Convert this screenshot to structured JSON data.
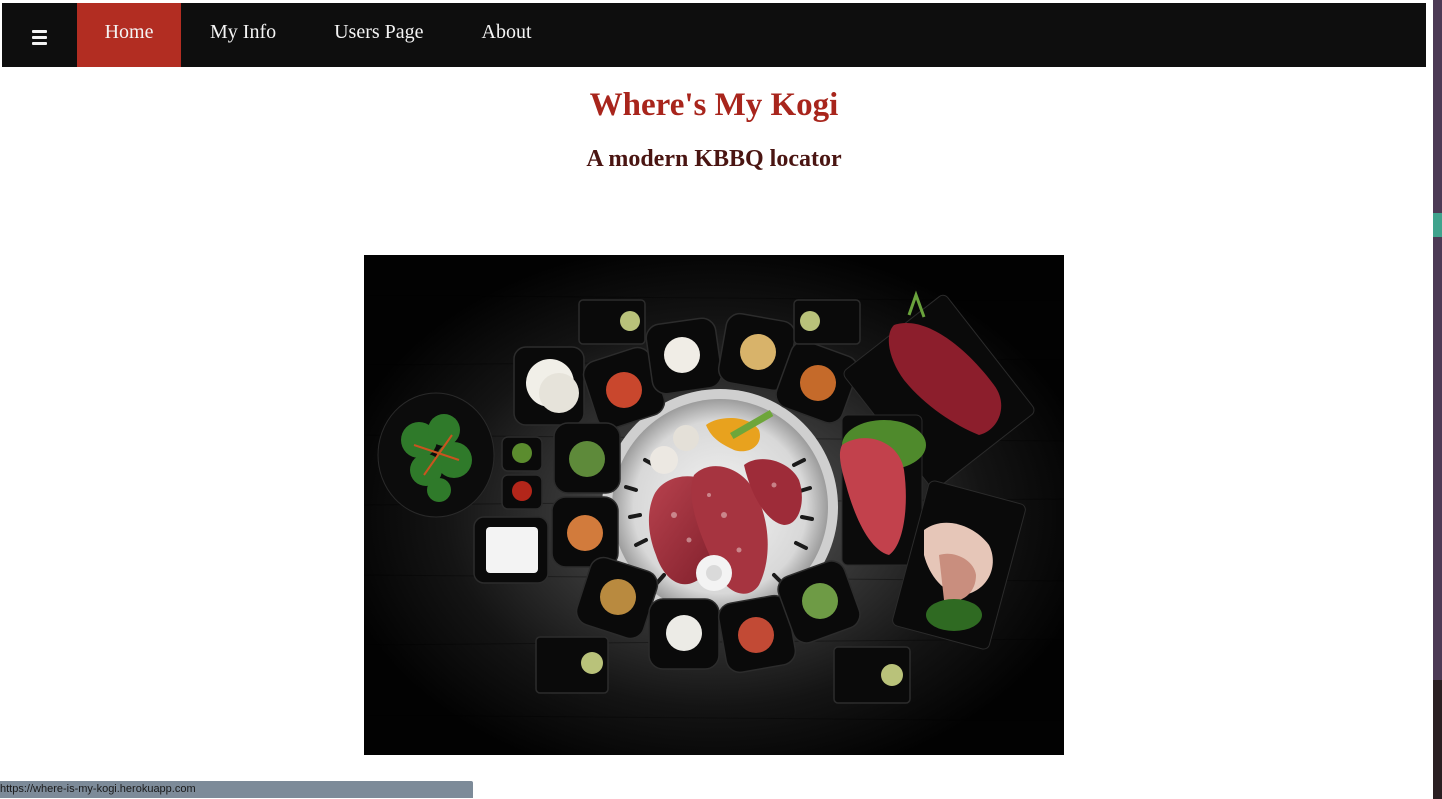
{
  "nav": {
    "menu_icon": "hamburger-menu-icon",
    "items": [
      {
        "label": "Home",
        "active": true
      },
      {
        "label": "My Info",
        "active": false
      },
      {
        "label": "Users Page",
        "active": false
      },
      {
        "label": "About",
        "active": false
      }
    ]
  },
  "header": {
    "title": "Where's My Kogi",
    "subtitle": "A modern KBBQ locator"
  },
  "status_bar": {
    "url": "https://where-is-my-kogi.herokuapp.com"
  },
  "colors": {
    "nav_background": "#0e0e0e",
    "nav_active": "#b22d22",
    "title": "#a8251c",
    "subtitle": "#4a1512"
  }
}
